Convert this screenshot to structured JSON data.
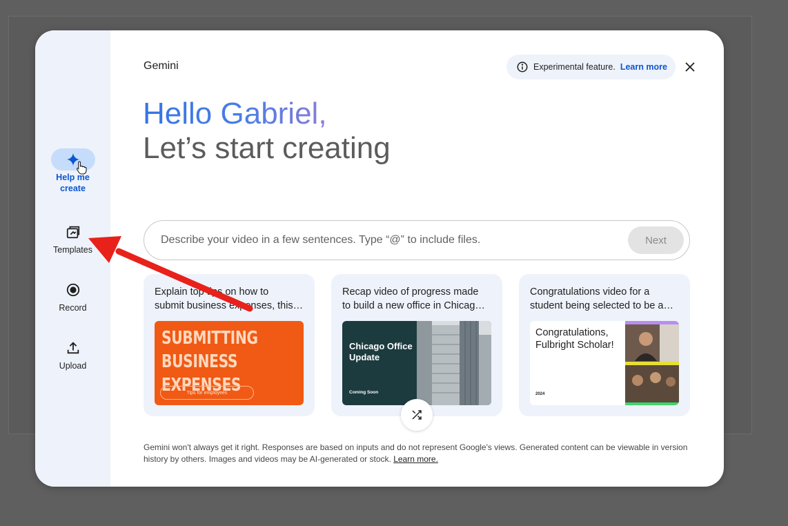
{
  "app": {
    "title": "Gemini"
  },
  "banner": {
    "text": "Experimental feature.",
    "link": "Learn more"
  },
  "greeting": {
    "hello": "Hello Gabriel,",
    "subtitle": "Let’s start creating"
  },
  "rail": {
    "items": [
      {
        "label": "Help me create",
        "icon": "sparkle-icon",
        "active": true
      },
      {
        "label": "Templates",
        "icon": "templates-icon"
      },
      {
        "label": "Record",
        "icon": "record-icon"
      },
      {
        "label": "Upload",
        "icon": "upload-icon"
      }
    ]
  },
  "prompt": {
    "placeholder": "Describe your video in a few sentences. Type “@” to include files.",
    "next_label": "Next"
  },
  "cards": [
    {
      "line1": "Explain top tips on how to",
      "line2": "submit business expenses, this…",
      "thumb_text": "SUBMITTING BUSINESS EXPENSES",
      "thumb_sub": "Tips for employees"
    },
    {
      "line1": "Recap video of progress made",
      "line2": "to build a new office in Chicag…",
      "thumb_text": "Chicago Office Update",
      "thumb_sub": "Coming Soon"
    },
    {
      "line1": "Congratulations video for a",
      "line2": "student being selected to be a…",
      "thumb_text": "Congratulations, Fulbright Scholar!",
      "thumb_sub": "2024"
    }
  ],
  "disclaimer": {
    "text": "Gemini won't always get it right. Responses are based on inputs and do not represent Google's views. Generated content can be viewable in version history by others. Images and videos may be AI-generated or stock.",
    "link": "Learn more."
  },
  "colors": {
    "accent": "#0b57d0",
    "rail_bg": "#eef2fa",
    "active_pill": "#c6dcfb",
    "annotation_arrow": "#e8211b"
  }
}
